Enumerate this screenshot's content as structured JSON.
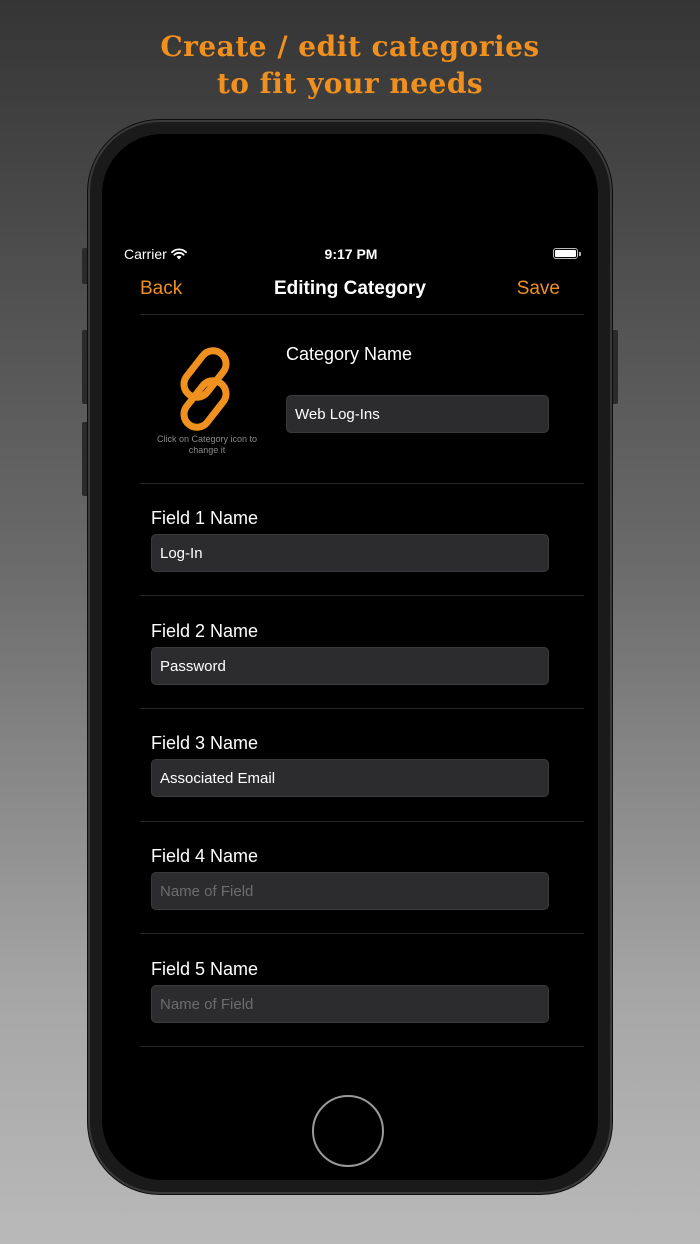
{
  "headline": {
    "line1": "Create / edit categories",
    "line2": "to fit your needs"
  },
  "status_bar": {
    "carrier": "Carrier",
    "time": "9:17 PM"
  },
  "nav": {
    "back": "Back",
    "title": "Editing Category",
    "save": "Save"
  },
  "category": {
    "icon": "link-icon",
    "hint": "Click on Category icon to change it",
    "name_label": "Category Name",
    "name_value": "Web Log-Ins"
  },
  "fields": [
    {
      "label": "Field 1 Name",
      "value": "Log-In",
      "placeholder": ""
    },
    {
      "label": "Field 2 Name",
      "value": "Password",
      "placeholder": ""
    },
    {
      "label": "Field 3 Name",
      "value": "Associated Email",
      "placeholder": ""
    },
    {
      "label": "Field 4 Name",
      "value": "",
      "placeholder": "Name of Field"
    },
    {
      "label": "Field 5 Name",
      "value": "",
      "placeholder": "Name of Field"
    }
  ],
  "colors": {
    "accent": "#f0901e",
    "background": "#000000",
    "field_bg": "#2c2c2e"
  }
}
